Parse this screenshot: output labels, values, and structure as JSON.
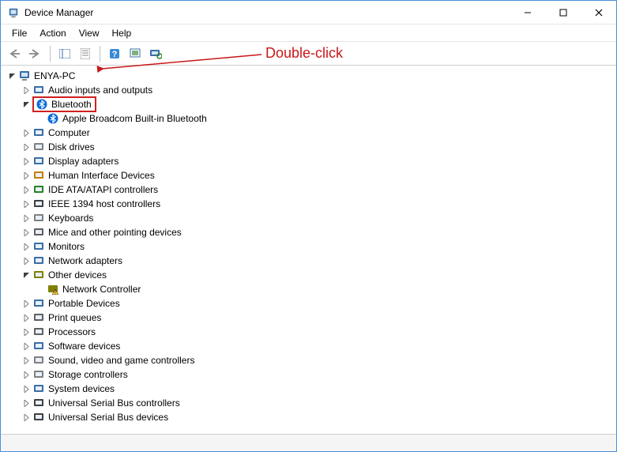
{
  "window": {
    "title": "Device Manager"
  },
  "menubar": {
    "items": [
      "File",
      "Action",
      "View",
      "Help"
    ]
  },
  "toolbar": {
    "names": [
      "nav-back-icon",
      "nav-forward-icon",
      "show-hide-console-tree-icon",
      "properties-icon",
      "help-icon",
      "update-driver-icon",
      "scan-hardware-icon"
    ]
  },
  "annotation": {
    "label": "Double-click"
  },
  "tree": {
    "root": {
      "label": "ENYA-PC",
      "expanded": true,
      "children": [
        {
          "label": "Audio inputs and outputs",
          "expanded": false,
          "iconColor": "#3a6ea5"
        },
        {
          "label": "Bluetooth",
          "expanded": true,
          "highlighted": true,
          "iconColor": "#0a6ad8",
          "children": [
            {
              "label": "Apple Broadcom Built-in Bluetooth",
              "leaf": true,
              "iconColor": "#0a6ad8"
            }
          ]
        },
        {
          "label": "Computer",
          "expanded": false,
          "iconColor": "#3a6ea5"
        },
        {
          "label": "Disk drives",
          "expanded": false,
          "iconColor": "#808080"
        },
        {
          "label": "Display adapters",
          "expanded": false,
          "iconColor": "#3a6ea5"
        },
        {
          "label": "Human Interface Devices",
          "expanded": false,
          "iconColor": "#c08000"
        },
        {
          "label": "IDE ATA/ATAPI controllers",
          "expanded": false,
          "iconColor": "#2a802a"
        },
        {
          "label": "IEEE 1394 host controllers",
          "expanded": false,
          "iconColor": "#404040"
        },
        {
          "label": "Keyboards",
          "expanded": false,
          "iconColor": "#808080"
        },
        {
          "label": "Mice and other pointing devices",
          "expanded": false,
          "iconColor": "#606060"
        },
        {
          "label": "Monitors",
          "expanded": false,
          "iconColor": "#3a6ea5"
        },
        {
          "label": "Network adapters",
          "expanded": false,
          "iconColor": "#3a6ea5"
        },
        {
          "label": "Other devices",
          "expanded": true,
          "iconColor": "#808000",
          "children": [
            {
              "label": "Network Controller",
              "leaf": true,
              "warn": true,
              "iconColor": "#808000"
            }
          ]
        },
        {
          "label": "Portable Devices",
          "expanded": false,
          "iconColor": "#3a6ea5"
        },
        {
          "label": "Print queues",
          "expanded": false,
          "iconColor": "#606060"
        },
        {
          "label": "Processors",
          "expanded": false,
          "iconColor": "#606060"
        },
        {
          "label": "Software devices",
          "expanded": false,
          "iconColor": "#3a6ea5"
        },
        {
          "label": "Sound, video and game controllers",
          "expanded": false,
          "iconColor": "#808080"
        },
        {
          "label": "Storage controllers",
          "expanded": false,
          "iconColor": "#808080"
        },
        {
          "label": "System devices",
          "expanded": false,
          "iconColor": "#3a6ea5"
        },
        {
          "label": "Universal Serial Bus controllers",
          "expanded": false,
          "iconColor": "#404040"
        },
        {
          "label": "Universal Serial Bus devices",
          "expanded": false,
          "iconColor": "#404040"
        }
      ]
    }
  }
}
